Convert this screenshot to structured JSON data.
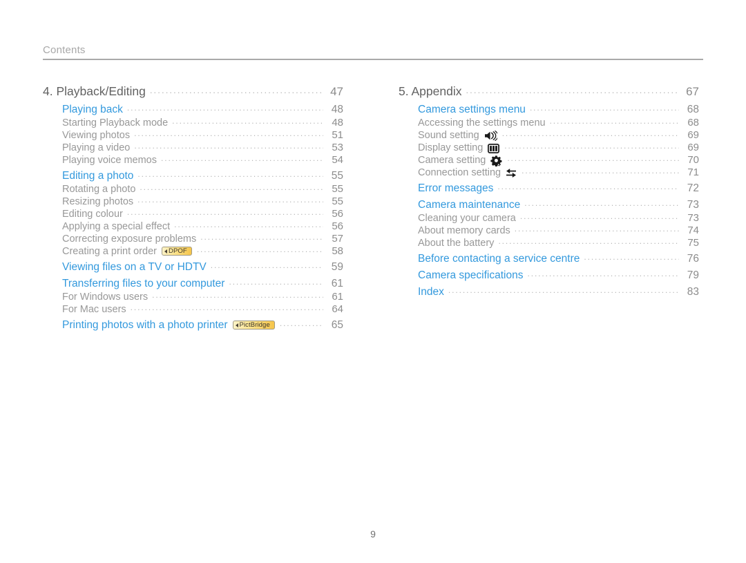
{
  "header": {
    "title": "Contents"
  },
  "footer": {
    "page_number": "9"
  },
  "colors": {
    "section_blue": "#3399dd",
    "sub_gray": "#989898",
    "chapter_gray": "#626262",
    "page_gray": "#8c8c8c",
    "rule_gray": "#a9a9a9",
    "badge_border": "#a09a84",
    "badge_gradient_start": "#fdf3c8",
    "badge_gradient_end": "#f6c54a"
  },
  "left_column": {
    "chapter": {
      "label": "4. Playback/Editing",
      "page": "47"
    },
    "entries": [
      {
        "level": "section",
        "label": "Playing back",
        "page": "48"
      },
      {
        "level": "sub",
        "label": "Starting Playback mode",
        "page": "48"
      },
      {
        "level": "sub",
        "label": "Viewing photos",
        "page": "51"
      },
      {
        "level": "sub",
        "label": "Playing a video",
        "page": "53"
      },
      {
        "level": "sub",
        "label": "Playing voice memos",
        "page": "54"
      },
      {
        "level": "section",
        "label": "Editing a photo",
        "page": "55"
      },
      {
        "level": "sub",
        "label": "Rotating a photo",
        "page": "55"
      },
      {
        "level": "sub",
        "label": "Resizing photos",
        "page": "55"
      },
      {
        "level": "sub",
        "label": "Editing colour",
        "page": "56"
      },
      {
        "level": "sub",
        "label": "Applying a special effect",
        "page": "56"
      },
      {
        "level": "sub",
        "label": "Correcting exposure problems",
        "page": "57"
      },
      {
        "level": "sub",
        "label": "Creating a print order",
        "page": "58",
        "badge": "DPOF"
      },
      {
        "level": "section",
        "label": "Viewing files on a TV or HDTV",
        "page": "59"
      },
      {
        "level": "section",
        "label": "Transferring files to your computer",
        "page": "61"
      },
      {
        "level": "sub",
        "label": "For Windows users",
        "page": "61"
      },
      {
        "level": "sub",
        "label": "For Mac users",
        "page": "64"
      },
      {
        "level": "section",
        "label": "Printing photos with a photo printer",
        "page": "65",
        "badge": "PictBridge"
      }
    ]
  },
  "right_column": {
    "chapter": {
      "label": "5. Appendix",
      "page": "67"
    },
    "entries": [
      {
        "level": "section",
        "label": "Camera settings menu",
        "page": "68"
      },
      {
        "level": "sub",
        "label": "Accessing the settings menu",
        "page": "68"
      },
      {
        "level": "sub",
        "label": "Sound setting",
        "page": "69",
        "icon": "speaker-icon"
      },
      {
        "level": "sub",
        "label": "Display setting",
        "page": "69",
        "icon": "display-icon"
      },
      {
        "level": "sub",
        "label": "Camera setting",
        "page": "70",
        "icon": "gear-icon"
      },
      {
        "level": "sub",
        "label": "Connection setting",
        "page": "71",
        "icon": "connection-arrows-icon"
      },
      {
        "level": "section",
        "label": "Error messages",
        "page": "72"
      },
      {
        "level": "section",
        "label": "Camera maintenance",
        "page": "73"
      },
      {
        "level": "sub",
        "label": "Cleaning your camera",
        "page": "73"
      },
      {
        "level": "sub",
        "label": "About memory cards",
        "page": "74"
      },
      {
        "level": "sub",
        "label": "About the battery",
        "page": "75"
      },
      {
        "level": "section",
        "label": "Before contacting a service centre",
        "page": "76"
      },
      {
        "level": "section",
        "label": "Camera specifications",
        "page": "79"
      },
      {
        "level": "section",
        "label": "Index",
        "page": "83"
      }
    ]
  }
}
